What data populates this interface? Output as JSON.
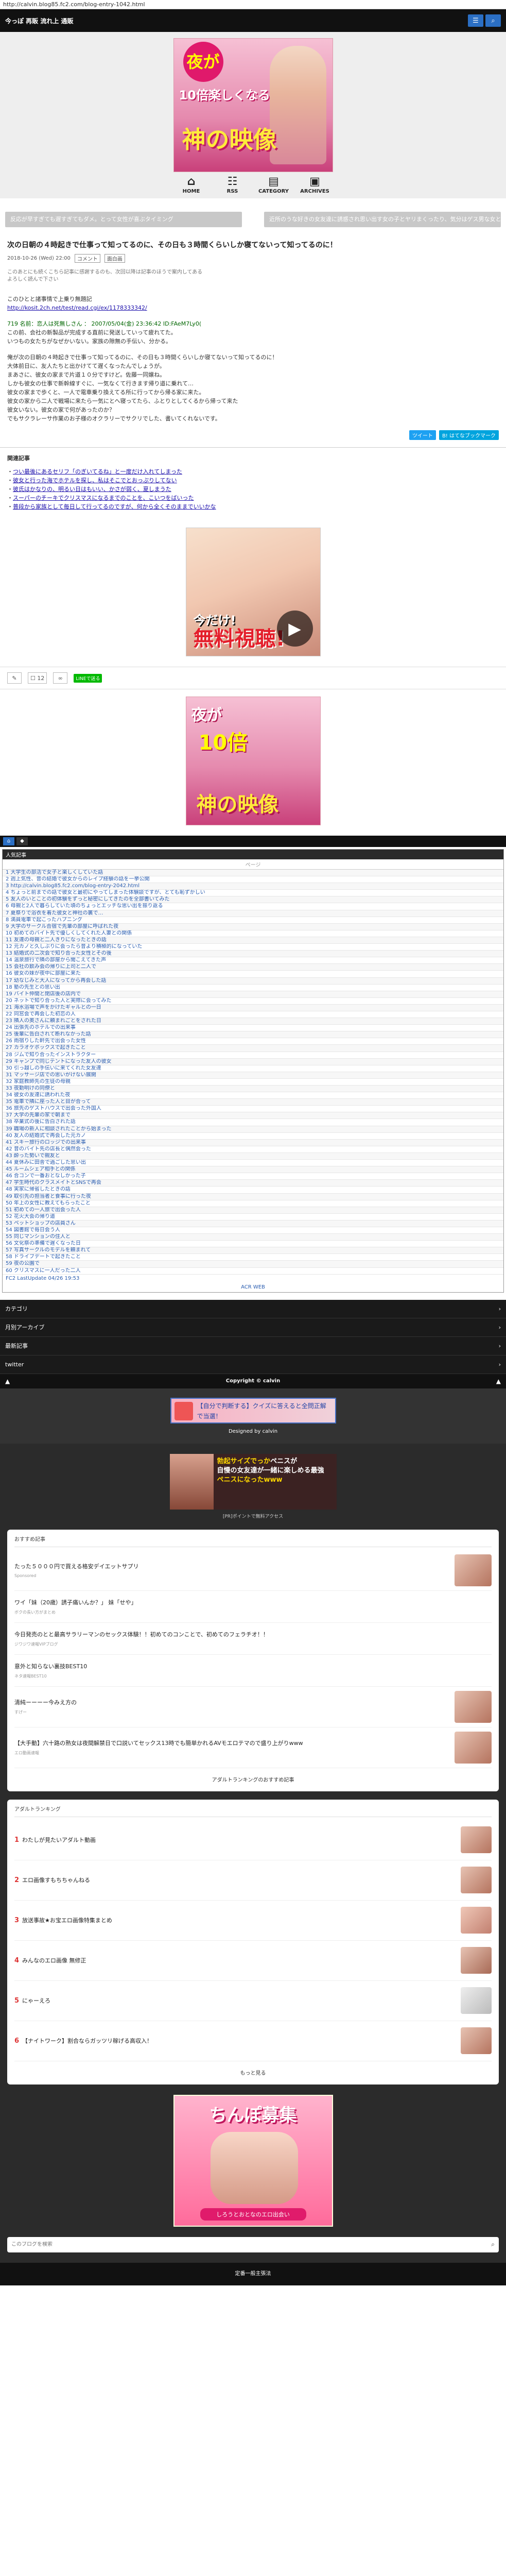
{
  "browser": {
    "url": "http://calvin.blog85.fc2.com/blog-entry-1042.html"
  },
  "header": {
    "site_title": "今っぽ 再販 流れ上 通販",
    "banner": {
      "circle_text": "夜が",
      "line1": "10倍楽しくなる",
      "line2": "神の映像"
    },
    "icons": [
      {
        "label": "HOME",
        "icon": "home-icon"
      },
      {
        "label": "RSS",
        "icon": "rss-icon"
      },
      {
        "label": "CATEGORY",
        "icon": "folder-icon"
      },
      {
        "label": "ARCHIVES",
        "icon": "archive-icon"
      }
    ]
  },
  "entry_nav": {
    "prev": "反応が早すぎても遅すぎてもダメ。とって女性が喜ぶタイミング",
    "next": "近所のうな好きの女友達に誘惑され思い出す女の子とヤリまくったり、気分はゲス男な女とSEX"
  },
  "article": {
    "title": "次の日朝の４時起きで仕事って知ってるのに、その日も３時間くらいしか寝てないって知ってるのに！",
    "date": "2018-10-26 (Wed) 22:00",
    "comments": "コメント",
    "category": "面白画",
    "note_line1": "このあとにも続くこちら記事に感謝するのも、次回以降は記事のほうで案内してある",
    "note_line2": "よろしく読んで下さい",
    "intro": "このひとと諸事情で上乗り無題記",
    "source_link": "http://kosit.2ch.net/test/read.cgi/ex/1178333342/",
    "post_header": "719 名前：恋人は死無しさん ： 2007/05/04(金) 23:36:42 ID:FAeM7Ly0(",
    "paragraphs": [
      "この前、会社の新製品が完成する直前に発送していって疲れてた。",
      "いつもの女たちがなぜかいない。家族の隙無の手伝い、分かる。",
      "",
      "俺が次の日朝の４時起きで仕事って知ってるのに、その日も３時間くらいしか寝てないって知ってるのに！",
      "大体前日に、友人たちと出かけてて遅くなったんでしょうが。",
      "まあさに、彼女の家まで片道１０分ですけど。佐藤一同嬢ね。",
      "しかも彼女の仕事で新幹線すぐに、一気なくて行きます帰り道に乗れて…",
      "彼女の家まで歩くと、一人で電車乗り換えてる所に行ってから帰る家に来た。",
      "彼女の家から二人で戦場に来たら一気にとへ寝ってたら、ふとりとしてくるから帰って来た",
      "彼女いない。彼女の家で何があったのか？",
      "でもサクラレーサ作業のお子様のオクラリーでサクリでした、書いてくれないです。"
    ]
  },
  "share": {
    "tweet": "ツイート",
    "hatena": "B! はてなブックマーク"
  },
  "related": {
    "heading": "関連記事",
    "items": [
      "つい最後にあるセリフ「のぎいてるね」と一度だけ入れてしまった",
      "彼女と行った海でホテルを探し、私はそこでとおっぷりしてない",
      "彼氏はかなりの、明るい日はもいい、かさが弱く、夏しまうた",
      "スーパーのチーキでクリスマスになるまでのことを、こいつをばいった",
      "普段から家族として毎日して行ってるのですが、何から全くそのままでいいかな"
    ]
  },
  "ads": {
    "ad1_line1": "今だけ!",
    "ad1_line2": "無料視聴!",
    "ad2_line1": "夜が",
    "ad2_line2": "10倍",
    "ad2_line3": "神の映像"
  },
  "actions": {
    "comment_count": "12",
    "line_label": "LINEで送る"
  },
  "ranking": {
    "heading": "人気記事",
    "pager": "ページ",
    "rows": [
      "1 大学生の部活で女子と楽しくしていた話",
      "2 週上気性、昔の結婚で彼女からのレイプ経験の話を一挙公開",
      "3 http://calvin.blog85.fc2.com/blog-entry-2042.html",
      "4 ちょっと前までの話で彼女と最初にやってしまった体験談ですが、とても恥ずかしい",
      "5 友人のいとことの初体験をずっと秘密にしてきたのを全部書いてみた",
      "6 母親と2人で暮らしていた頃のちょっとエッチな思い出を振り返る",
      "7 夏祭りで浴衣を着た彼女と神社の裏で…",
      "8 満員電車で起こったハプニング",
      "9 大学のサークル合宿で先輩の部屋に呼ばれた夜",
      "10 初めてのバイト先で優しくしてくれた人妻との関係",
      "11 友達の母親と二人きりになったときの話",
      "12 元カノと久しぶりに会ったら昔より積極的になっていた",
      "13 結婚式の二次会で知り合った女性とその後",
      "14 温泉旅行で隣の部屋から聞こえてきた声",
      "15 会社の飲み会の帰りに上司と二人で",
      "16 彼女の妹が夜中に部屋に来た",
      "17 幼なじみと大人になってから再会した話",
      "18 塾の先生との思い出",
      "19 バイト仲間と閉店後の店内で",
      "20 ネットで知り合った人と実際に会ってみた",
      "21 海水浴場で声をかけたギャルとの一日",
      "22 同窓会で再会した初恋の人",
      "23 隣人の奥さんに頼まれごとをされた日",
      "24 出張先のホテルでの出来事",
      "25 後輩に告白されて断れなかった話",
      "26 雨宿りした軒先で出会った女性",
      "27 カラオケボックスで起きたこと",
      "28 ジムで知り合ったインストラクター",
      "29 キャンプで同じテントになった友人の彼女",
      "30 引っ越しの手伝いに来てくれた女友達",
      "31 マッサージ店での思いがけない展開",
      "32 家庭教師先の生徒の母親",
      "33 夜勤明けの同僚と",
      "34 彼女の友達に誘われた夜",
      "35 電車で隣に座った人と目が合って",
      "36 旅先のゲストハウスで出会った外国人",
      "37 大学の先輩の家で朝まで",
      "38 卒業式の後に告白された話",
      "39 職場の新人に相談されたことから始まった",
      "40 友人の結婚式で再会した元カノ",
      "41 スキー旅行のロッジでの出来事",
      "42 昔のバイト先の店長と偶然会った",
      "43 酔った勢いで親友と",
      "44 夏休みに田舎で過ごした思い出",
      "45 ルームシェア相手との関係",
      "46 合コンで一番おとなしかった子",
      "47 学生時代のクラスメイトとSNSで再会",
      "48 実家に帰省したときの話",
      "49 取引先の担当者と食事に行った夜",
      "50 年上の女性に教えてもらったこと",
      "51 初めての一人旅で出会った人",
      "52 花火大会の帰り道",
      "53 ペットショップの店員さん",
      "54 図書館で毎日会う人",
      "55 同じマンションの住人と",
      "56 文化祭の準備で遅くなった日",
      "57 写真サークルのモデルを頼まれて",
      "58 ドライブデートで起きたこと",
      "59 夜の公園で",
      "60 クリスマスに一人だった二人"
    ],
    "footer": "FC2 LastUpdate 04/26 19:53",
    "more": "ACR WEB"
  },
  "side_nav": [
    "カテゴリ",
    "月別アーカイブ",
    "最新記事",
    "twitter"
  ],
  "footer": {
    "copyright": "Copyright © calvin",
    "fad_text": "【自分で判断する】クイズに答えると全問正解で当選！",
    "designed": "Designed by calvin"
  },
  "wide_ad": {
    "text1": "勃起サイズでっか",
    "text2": "ペニスが",
    "text3": "自慢の女友達が一緒に楽しめる最強",
    "text4": "ペニスになったwww",
    "caption": "[PR]ポイントで無料アクセス"
  },
  "recommend": {
    "heading": "おすすめ記事",
    "items": [
      {
        "title": "たった５０００円で買える格安デイエットサプリ",
        "sub": "Sponsored"
      },
      {
        "title": "ワイ「妹（20歳）誘子痛いんか？」 妹「せや」",
        "sub": "ボクの長い方がまとめ"
      },
      {
        "title": "今日発売のとと最高サラリーマンのセックス体験！！初めてのコンことで、初めてのフェラチオ！！",
        "sub": "ジワジワ速報VIPブログ"
      },
      {
        "title": "意外と知らない裏技BEST10",
        "sub": "ネタ速報BEST10"
      },
      {
        "title": "清純ーーーー今みえ方の",
        "sub": "すげー"
      },
      {
        "title": "【大手動】六十路の熟女は夜間解禁日で口説いてセックス13時でも簡単かれるAVモエロテマので盛り上がりwww",
        "sub": "エロ動画速報"
      }
    ],
    "more": "アダルトランキングのおすすめ記事"
  },
  "adult_ranking": {
    "heading": "アダルトランキング",
    "items": [
      {
        "num": "1",
        "title": "わたしが見たいアダルト動画"
      },
      {
        "num": "2",
        "title": "エロ画像すもちちゃんねる"
      },
      {
        "num": "3",
        "title": "放送事故★お宝エロ画像特集まとめ"
      },
      {
        "num": "4",
        "title": "みんなのエロ画像 無修正"
      },
      {
        "num": "5",
        "title": "にゃーえろ"
      },
      {
        "num": "6",
        "title": "【ナイトワーク】割合ならガッツリ稼げる高収入！"
      }
    ],
    "more": "もっと見る"
  },
  "bottom_ad": {
    "title": "ちんぽ募集",
    "sub": "しろうとおとなのエロ出会い"
  },
  "search": {
    "placeholder": "このブログを検索"
  },
  "final": {
    "text": "定番一般主張法"
  },
  "colors": {
    "accent_blue": "#2b6fc4",
    "dark": "#111111"
  }
}
